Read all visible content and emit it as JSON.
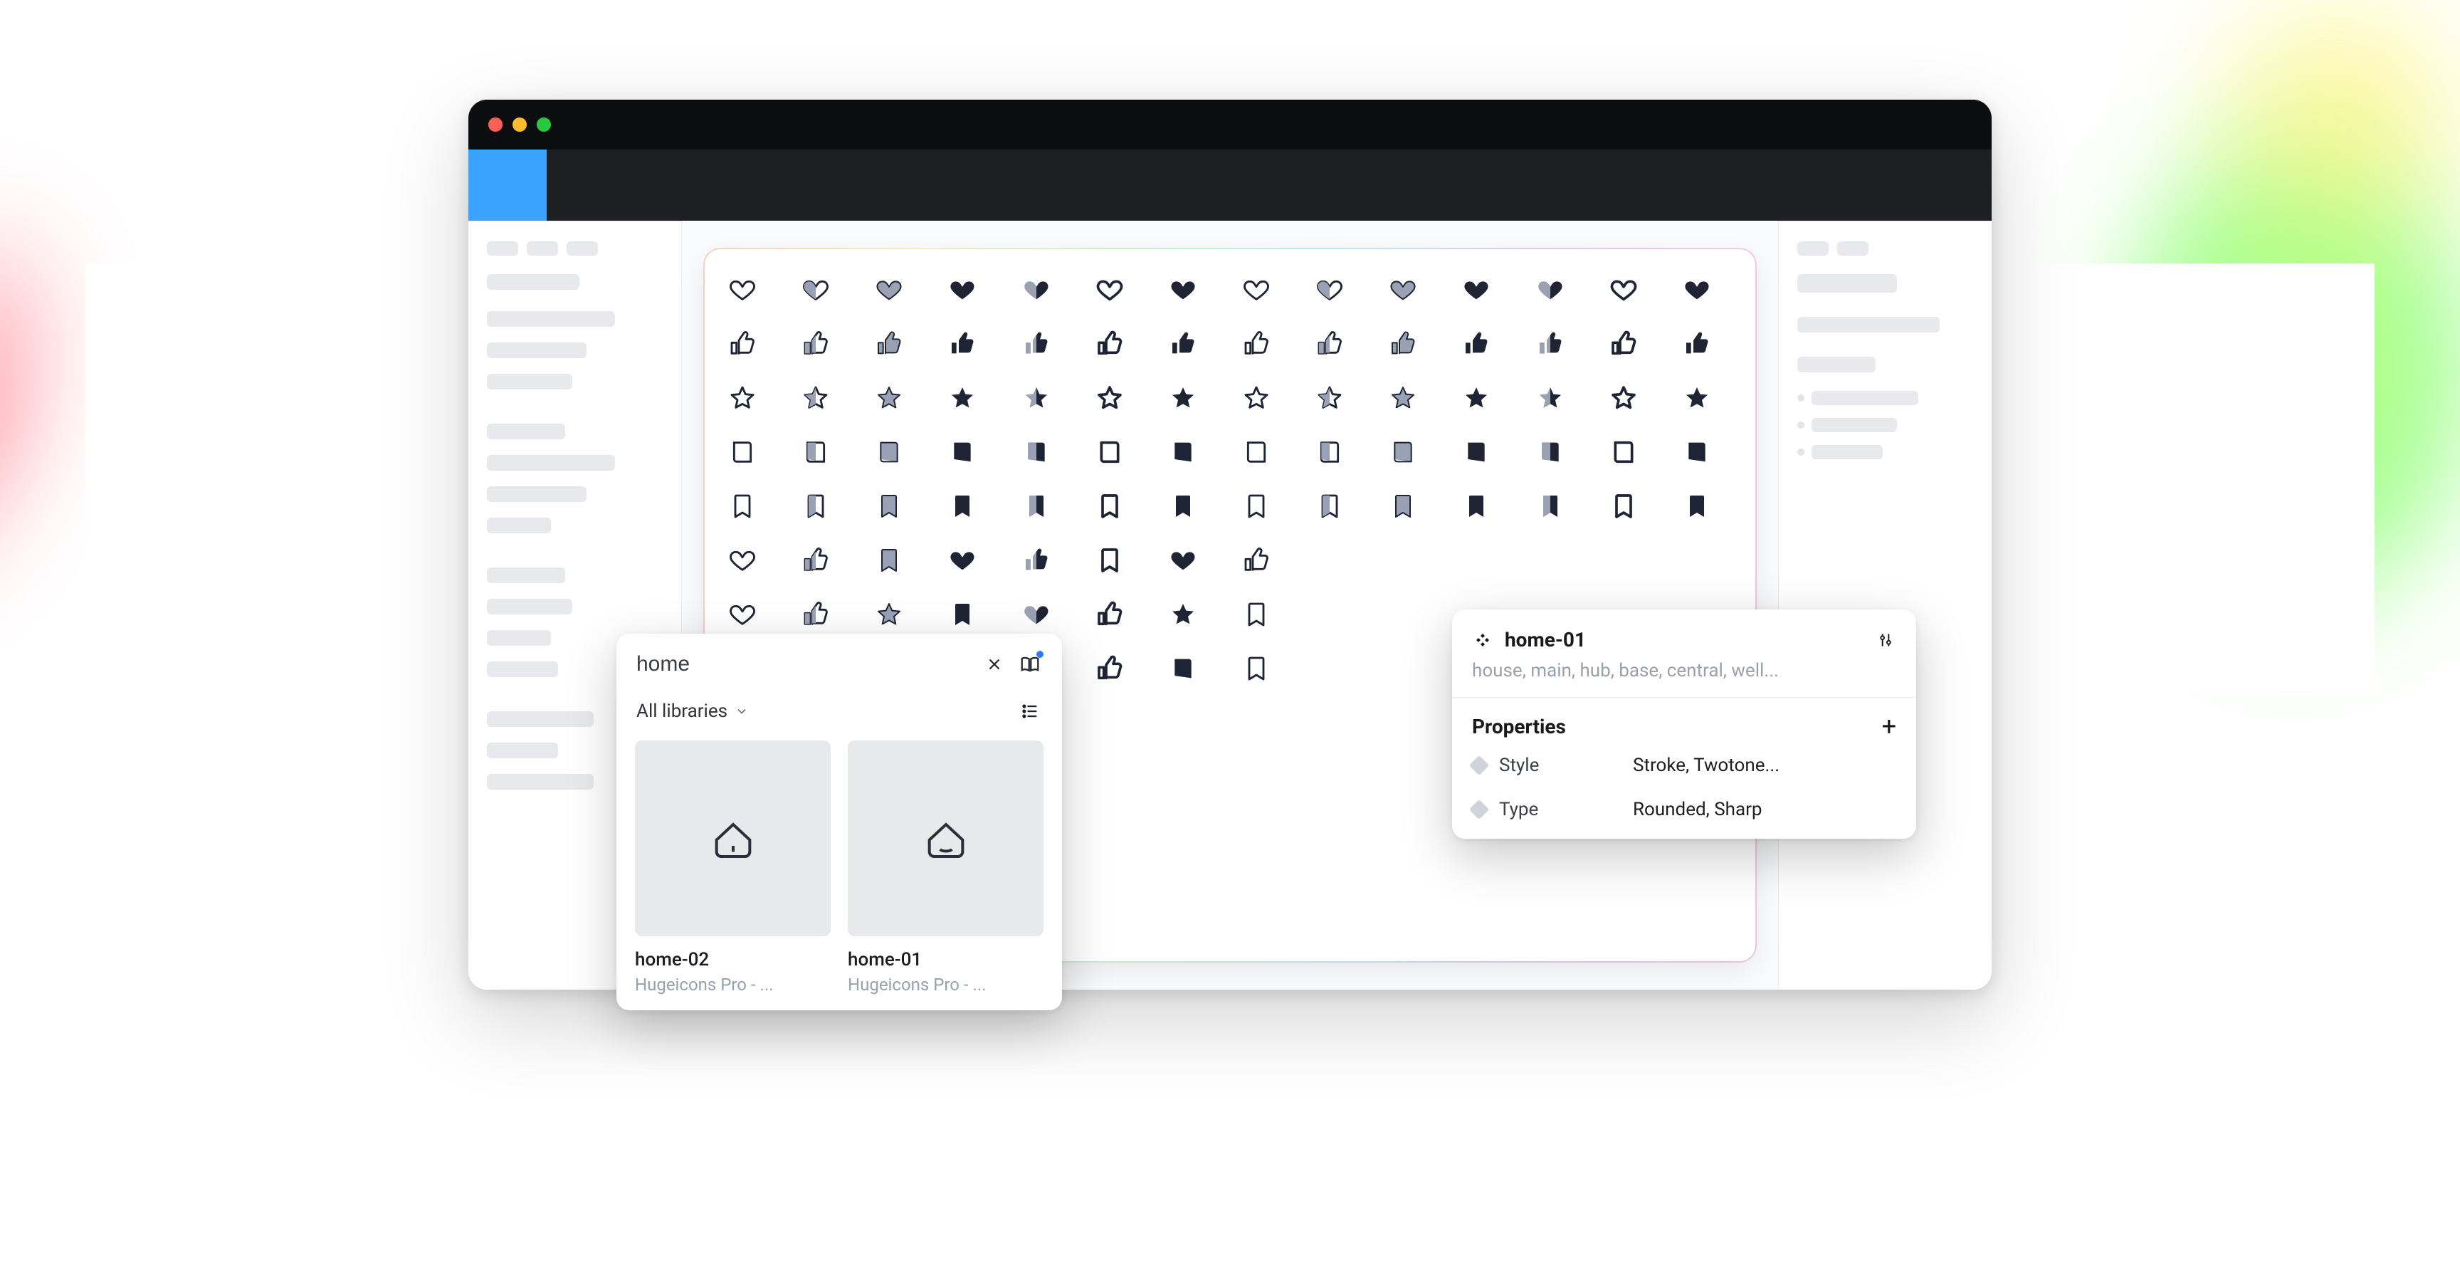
{
  "assets_panel": {
    "search_value": "home",
    "library_filter": "All libraries",
    "results": [
      {
        "name": "home-02",
        "source": "Hugeicons Pro - ..."
      },
      {
        "name": "home-01",
        "source": "Hugeicons Pro - ..."
      }
    ]
  },
  "properties_panel": {
    "component_name": "home-01",
    "tags_preview": "house, main, hub, base, central, well...",
    "section_title": "Properties",
    "rows": [
      {
        "key": "Style",
        "value": "Stroke, Twotone..."
      },
      {
        "key": "Type",
        "value": "Rounded, Sharp"
      }
    ]
  },
  "artboard_icons": {
    "families": [
      "heart",
      "thumbs-up",
      "star",
      "book",
      "bookmark"
    ],
    "variants_per_row": 14
  },
  "colors": {
    "ink": "#1e2433",
    "muted": "#9aa1b5",
    "accent": "#3aa2ff"
  }
}
